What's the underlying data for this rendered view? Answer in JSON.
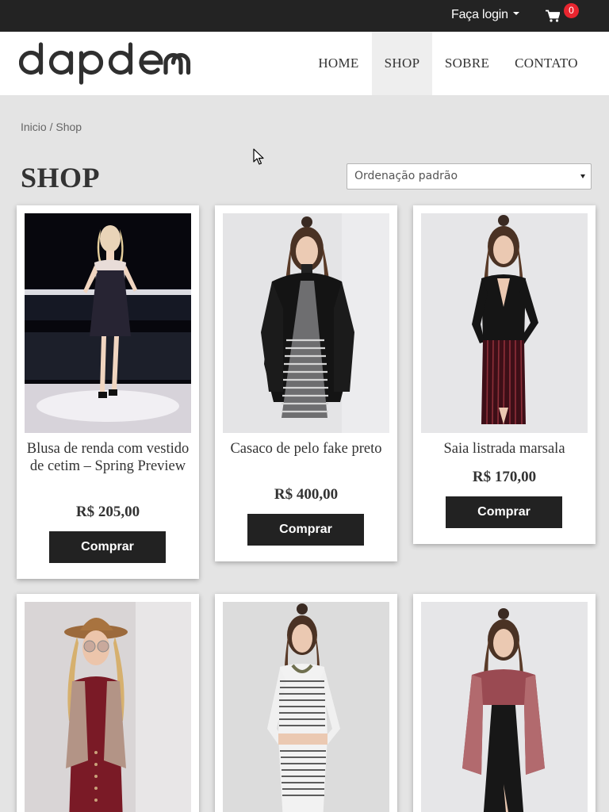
{
  "topbar": {
    "login_label": "Faça login",
    "cart_count": "0"
  },
  "header": {
    "logo_text": "dapdem",
    "nav": [
      {
        "label": "HOME",
        "active": false
      },
      {
        "label": "SHOP",
        "active": true
      },
      {
        "label": "SOBRE",
        "active": false
      },
      {
        "label": "CONTATO",
        "active": false
      }
    ]
  },
  "breadcrumb": "Inicio / Shop",
  "page_title": "SHOP",
  "sort": {
    "selected": "Ordenação padrão"
  },
  "products": [
    {
      "name": "Blusa de renda com vestido de cetim – Spring Preview",
      "price": "R$ 205,00",
      "button": "Comprar"
    },
    {
      "name": "Casaco de pelo fake preto",
      "price": "R$ 400,00",
      "button": "Comprar"
    },
    {
      "name": "Saia listrada marsala",
      "price": "R$ 170,00",
      "button": "Comprar"
    },
    {
      "name": "",
      "price": "",
      "button": ""
    },
    {
      "name": "",
      "price": "",
      "button": ""
    },
    {
      "name": "",
      "price": "",
      "button": ""
    }
  ],
  "colors": {
    "topbar": "#232323",
    "badge": "#e8252f",
    "button": "#222222",
    "background": "#e4e4e4"
  },
  "icons": {
    "cart": "shopping-cart-icon",
    "dropdown": "caret-down-icon"
  }
}
